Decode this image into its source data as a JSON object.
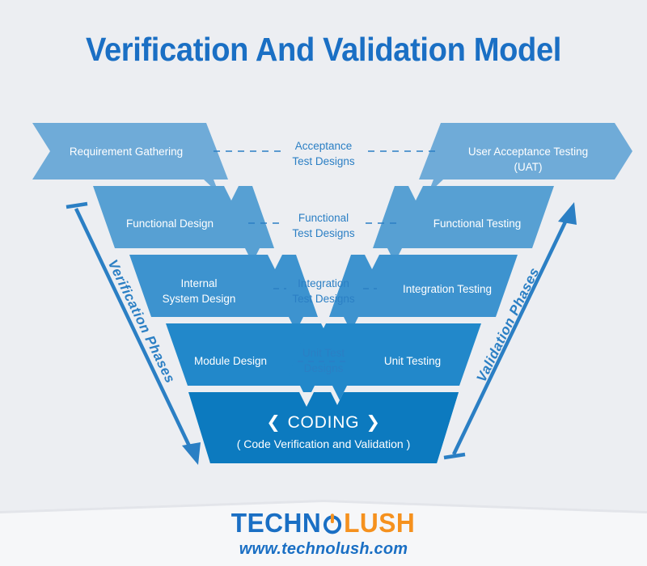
{
  "page": {
    "title": "Verification And Validation Model",
    "background_color": "#eceef2",
    "accent_color": "#1a6fc4"
  },
  "diagram": {
    "type": "v-model",
    "left_column_heading": "Verification Phases",
    "right_column_heading": "Validation Phases",
    "levels": [
      {
        "index": 1,
        "left": "Requirement Gathering",
        "connector": "Acceptance\nTest Designs",
        "connector_line1": "Acceptance",
        "connector_line2": "Test Designs",
        "right_line1": "User Acceptance Testing",
        "right_line2": "(UAT)",
        "color": "#6fabd8"
      },
      {
        "index": 2,
        "left": "Functional Design",
        "connector_line1": "Functional",
        "connector_line2": "Test Designs",
        "right_line1": "Functional Testing",
        "right_line2": "",
        "color": "#57a0d3"
      },
      {
        "index": 3,
        "left_line1": "Internal",
        "left_line2": "System Design",
        "connector_line1": "Integration",
        "connector_line2": "Test Designs",
        "right_line1": "Integration Testing",
        "right_line2": "",
        "color": "#3d93cf"
      },
      {
        "index": 4,
        "left": "Module Design",
        "connector_line1": "Unit Test",
        "connector_line2": "Designs",
        "right_line1": "Unit Testing",
        "right_line2": "",
        "color": "#2288ca"
      }
    ],
    "bottom": {
      "label": "CODING",
      "left_chevron": "❮",
      "right_chevron": "❯",
      "sublabel": "( Code Verification and Validation )",
      "color": "#0c7abf"
    }
  },
  "footer": {
    "logo_part1": "TECHN",
    "logo_part2": "LUSH",
    "logo_icon": "power-o-icon",
    "website": "www.technolush.com",
    "logo_blue": "#1a6fc4",
    "logo_orange": "#f5911e"
  }
}
